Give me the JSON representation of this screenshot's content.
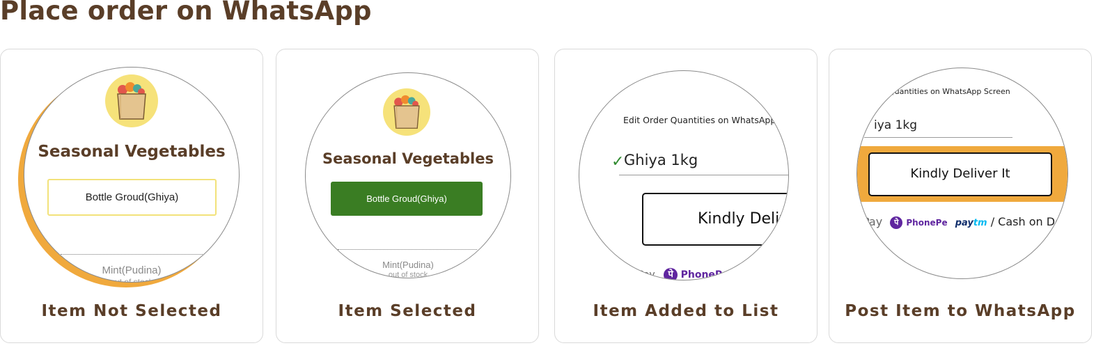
{
  "page": {
    "title": "Place order on WhatsApp"
  },
  "colors": {
    "brown": "#5a3e28",
    "orange": "#f0a93d",
    "green": "#3a7d23",
    "yellow": "#f6e27a",
    "phonepe": "#5f259f"
  },
  "steps": [
    {
      "caption": "Item Not Selected",
      "category": "Seasonal Vegetables",
      "item_label": "Bottle Groud(Ghiya)",
      "next_item": "Mint(Pudina)",
      "next_item_status": "out of stock"
    },
    {
      "caption": "Item Selected",
      "category": "Seasonal Vegetables",
      "item_label": "Bottle Groud(Ghiya)",
      "next_item": "Mint(Pudina)",
      "next_item_status": "out of stock"
    },
    {
      "caption": "Item Added to List",
      "screen_caption": "Edit Order Quantities on WhatsApp Sc",
      "order_line": "Ghiya 1kg",
      "button_label": "Kindly Deliv",
      "pay_partial": "Pay",
      "phonepe": "PhoneP"
    },
    {
      "caption": "Post Item to WhatsApp",
      "screen_caption": "Quantities on WhatsApp Screen",
      "order_line": "iya 1kg",
      "button_label": "Kindly Deliver It",
      "pay_partial": "Pay",
      "phonepe": "PhonePe",
      "paytm_pay": "pay",
      "paytm_tm": "tm",
      "cash": "/ Cash on Delive"
    }
  ],
  "icons": {
    "bag": "grocery-bag-icon",
    "check": "checkmark-icon"
  }
}
